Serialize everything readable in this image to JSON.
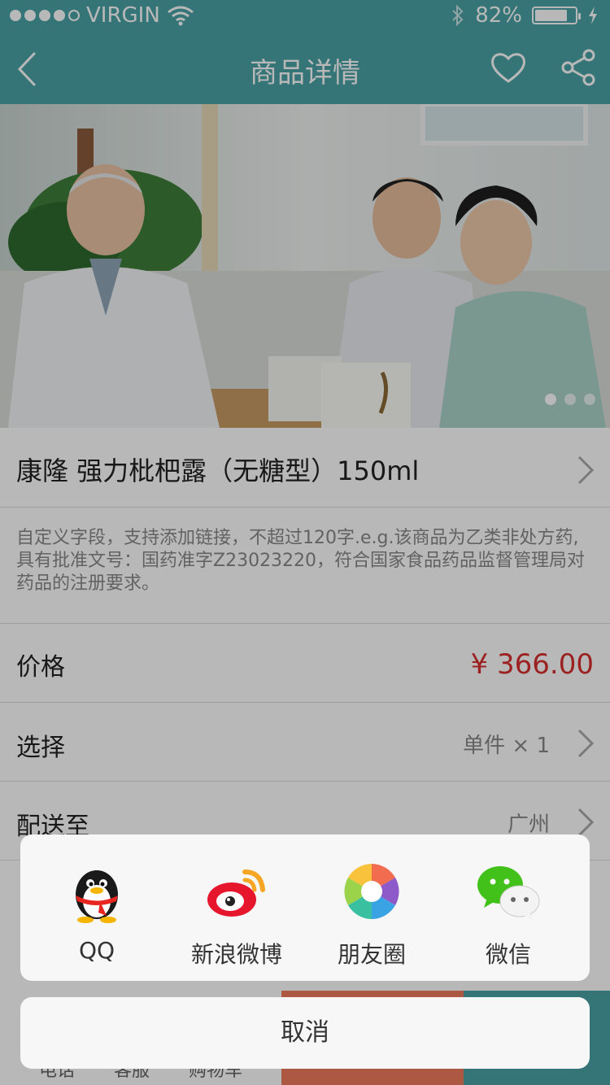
{
  "status_bar": {
    "carrier": "VIRGIN",
    "battery_text": "82%",
    "battery_level": 0.82,
    "signal_bars": 4,
    "signal_total": 5
  },
  "nav": {
    "title": "商品详情"
  },
  "hero": {
    "pager_count": 3,
    "pager_active": 0
  },
  "product": {
    "title": "康隆 强力枇杷露（无糖型）150ml",
    "description": "自定义字段，支持添加链接，不超过120字.e.g.该商品为乙类非处方药,具有批准文号：国药准字Z23023220，符合国家食品药品监督管理局对药品的注册要求。",
    "price_label": "价格",
    "price_value": "¥ 366.00",
    "select_label": "选择",
    "select_value": "单件 × 1",
    "ship_label": "配送至",
    "ship_value": "广州"
  },
  "footer": {
    "items": [
      "电话",
      "客服",
      "购物车"
    ]
  },
  "share_sheet": {
    "items": [
      {
        "label": "QQ",
        "icon": "qq-icon"
      },
      {
        "label": "新浪微博",
        "icon": "weibo-icon"
      },
      {
        "label": "朋友圈",
        "icon": "moments-icon"
      },
      {
        "label": "微信",
        "icon": "wechat-icon"
      }
    ],
    "cancel_label": "取消"
  },
  "colors": {
    "theme": "#4aa2a6",
    "price": "#d82f2f",
    "cart": "#f07a5c"
  }
}
